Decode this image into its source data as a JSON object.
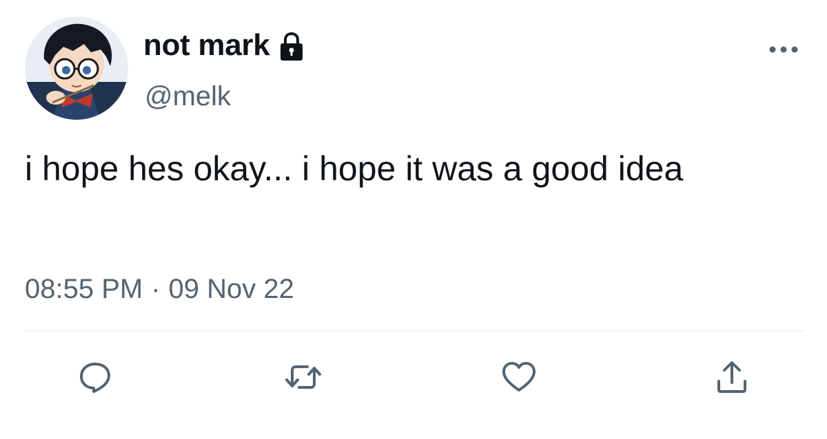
{
  "author": {
    "display_name": "not mark",
    "handle": "@melk",
    "protected": true,
    "avatar_icon": "anime-character-avatar"
  },
  "tweet": {
    "text": "i hope hes okay... i hope it was a good idea",
    "time": "08:55 PM",
    "separator": "·",
    "date": "09 Nov 22"
  },
  "actions": {
    "reply_icon": "reply-icon",
    "retweet_icon": "retweet-icon",
    "like_icon": "heart-icon",
    "share_icon": "share-icon"
  },
  "colors": {
    "text_primary": "#0f1419",
    "text_secondary": "#536471",
    "divider": "#eff3f4"
  }
}
